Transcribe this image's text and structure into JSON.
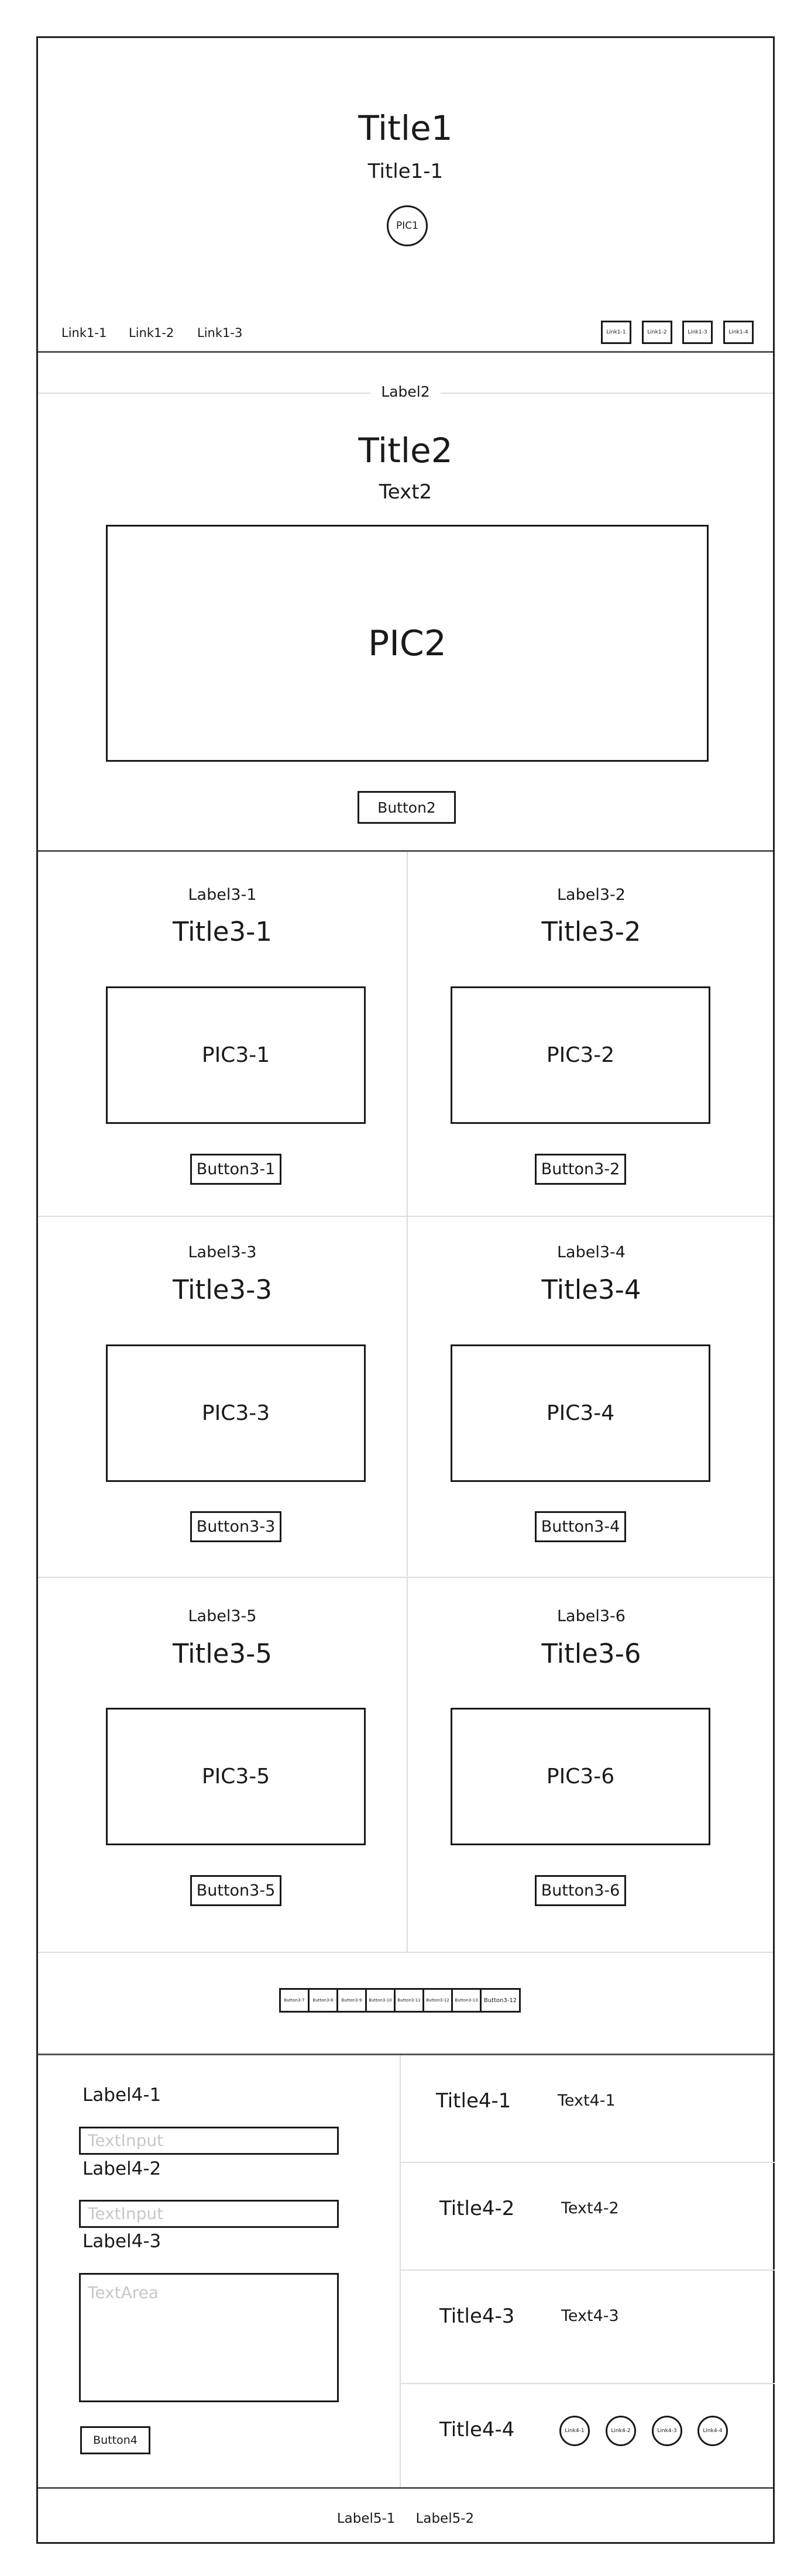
{
  "section1": {
    "title": "Title1",
    "subtitle": "Title1-1",
    "pic": "PIC1",
    "links": [
      "Link1-1",
      "Link1-2",
      "Link1-3"
    ],
    "small_links": [
      "Link1-1",
      "Link1-2",
      "Link1-3",
      "Link1-4"
    ]
  },
  "section2": {
    "label": "Label2",
    "title": "Title2",
    "text": "Text2",
    "pic": "PIC2",
    "button": "Button2"
  },
  "section3": {
    "cards": [
      {
        "label": "Label3-1",
        "title": "Title3-1",
        "pic": "PIC3-1",
        "button": "Button3-1"
      },
      {
        "label": "Label3-2",
        "title": "Title3-2",
        "pic": "PIC3-2",
        "button": "Button3-2"
      },
      {
        "label": "Label3-3",
        "title": "Title3-3",
        "pic": "PIC3-3",
        "button": "Button3-3"
      },
      {
        "label": "Label3-4",
        "title": "Title3-4",
        "pic": "PIC3-4",
        "button": "Button3-4"
      },
      {
        "label": "Label3-5",
        "title": "Title3-5",
        "pic": "PIC3-5",
        "button": "Button3-5"
      },
      {
        "label": "Label3-6",
        "title": "Title3-6",
        "pic": "PIC3-6",
        "button": "Button3-6"
      }
    ],
    "pagination": [
      "Button3-7",
      "Button3-8",
      "Button3-9",
      "Button3-10",
      "Button3-11",
      "Button3-12",
      "Button3-13",
      "Button3-12"
    ]
  },
  "section4": {
    "form": {
      "label1": "Label4-1",
      "input1_placeholder": "TextInput",
      "label2": "Label4-2",
      "input2_placeholder": "TextInput",
      "label3": "Label4-3",
      "textarea_placeholder": "TextArea",
      "button": "Button4"
    },
    "rows": [
      {
        "title": "Title4-1",
        "text": "Text4-1"
      },
      {
        "title": "Title4-2",
        "text": "Text4-2"
      },
      {
        "title": "Title4-3",
        "text": "Text4-3"
      }
    ],
    "row4": {
      "title": "Title4-4",
      "links": [
        "Link4-1",
        "Link4-2",
        "Link4-3",
        "Link4-4"
      ]
    }
  },
  "footer": {
    "label1": "Label5-1",
    "label2": "Label5-2"
  }
}
